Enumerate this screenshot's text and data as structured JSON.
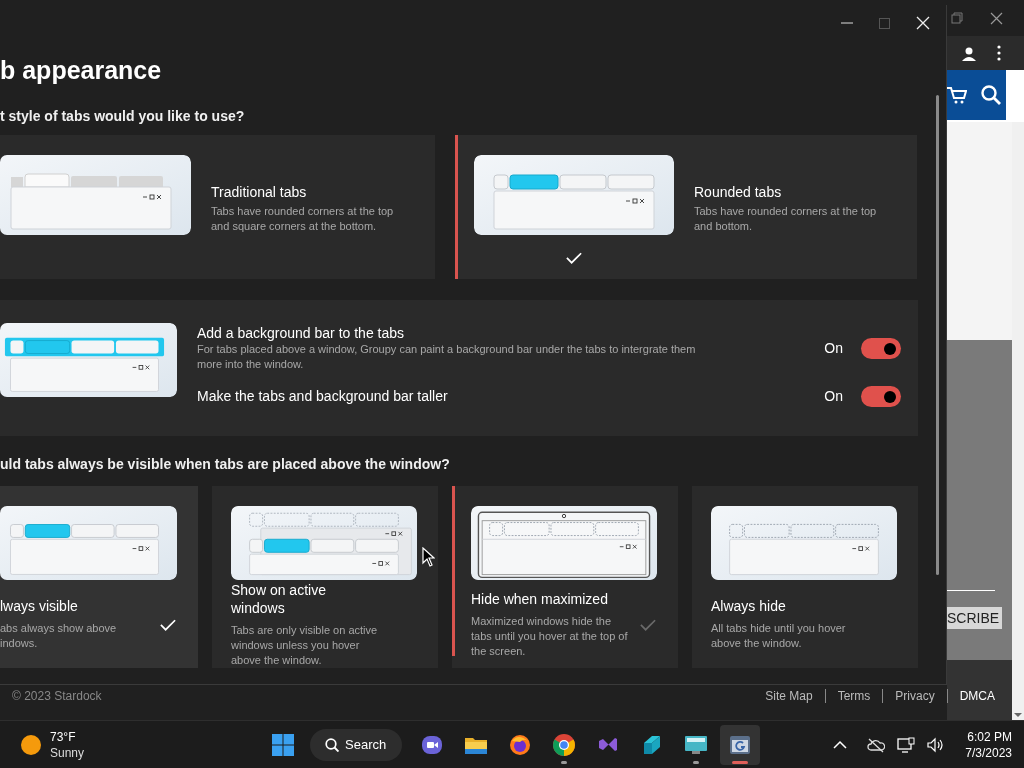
{
  "dialog": {
    "title": "b appearance"
  },
  "style_section": {
    "question": "t style of tabs would you like to use?",
    "options": [
      {
        "kind": "traditional",
        "title": "Traditional tabs",
        "description": "Tabs have rounded corners at the top and square corners at the bottom.",
        "selected": false,
        "focused": false
      },
      {
        "kind": "rounded",
        "title": "Rounded tabs",
        "description": "Tabs have rounded corners at the top and bottom.",
        "selected": true,
        "focused": true
      }
    ]
  },
  "background_bar": {
    "kind": "bar",
    "settings": [
      {
        "label": "Add a background bar to the tabs",
        "description": "For tabs placed above a window, Groupy can paint a background bar under the tabs to intergrate them more into the window.",
        "state_text": "On",
        "on": true
      },
      {
        "label": "Make the tabs and background bar taller",
        "state_text": "On",
        "on": true
      }
    ]
  },
  "visibility_section": {
    "question": "uld tabs always be visible when tabs are placed above the window?",
    "options": [
      {
        "kind": "always_visible",
        "title": "lways visible",
        "description": "abs always show above indows.",
        "selected": true,
        "focused": false
      },
      {
        "kind": "active_windows",
        "title": "Show on active windows",
        "description": "Tabs are only visible on active windows unless you hover above the window.",
        "selected": false,
        "focused": false
      },
      {
        "kind": "hide_maximized",
        "title": "Hide when maximized",
        "description": "Maximized windows hide the tabs until you hover at the top of the screen.",
        "selected": false,
        "focused": true
      },
      {
        "kind": "always_hide",
        "title": "Always hide",
        "description": "All tabs hide until you hover above the window.",
        "selected": false,
        "focused": false
      }
    ]
  },
  "browser": {
    "button": "SCRIBE",
    "footer": [
      "© 2023 Stardock",
      "Site Map",
      "Terms",
      "Privacy",
      "DMCA"
    ]
  },
  "taskbar": {
    "weather": {
      "temperature": "73°F",
      "condition": "Sunny"
    },
    "search": "Search",
    "apps": [
      {
        "kind": "meet",
        "running": false,
        "active": false
      },
      {
        "kind": "folder",
        "running": false,
        "active": false
      },
      {
        "kind": "firefox",
        "running": false,
        "active": false
      },
      {
        "kind": "chrome",
        "running": true,
        "active": false
      },
      {
        "kind": "studio",
        "running": false,
        "active": false
      },
      {
        "kind": "teal",
        "running": false,
        "active": false
      },
      {
        "kind": "monitor",
        "running": true,
        "active": false
      },
      {
        "kind": "groupy",
        "running": true,
        "active": true
      }
    ],
    "time": "6:02 PM",
    "date": "7/3/2023"
  }
}
